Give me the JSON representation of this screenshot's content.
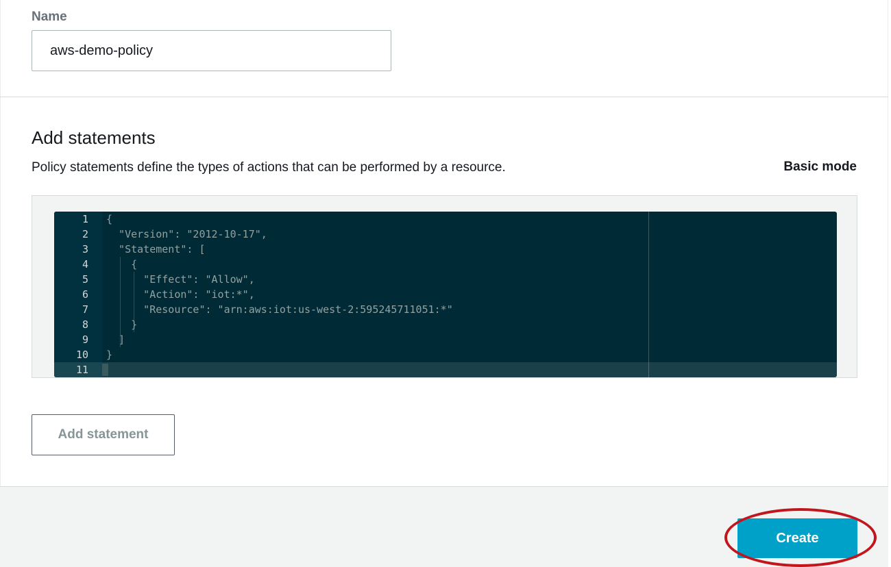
{
  "policy": {
    "name_label": "Name",
    "name_value": "aws-demo-policy"
  },
  "statements": {
    "title": "Add statements",
    "description": "Policy statements define the types of actions that can be performed by a resource.",
    "mode_link": "Basic mode"
  },
  "editor": {
    "lines": [
      {
        "num": "1",
        "code": "{"
      },
      {
        "num": "2",
        "code": "  \"Version\": \"2012-10-17\","
      },
      {
        "num": "3",
        "code": "  \"Statement\": ["
      },
      {
        "num": "4",
        "code": "    {"
      },
      {
        "num": "5",
        "code": "      \"Effect\": \"Allow\","
      },
      {
        "num": "6",
        "code": "      \"Action\": \"iot:*\","
      },
      {
        "num": "7",
        "code": "      \"Resource\": \"arn:aws:iot:us-west-2:595245711051:*\""
      },
      {
        "num": "8",
        "code": "    }"
      },
      {
        "num": "9",
        "code": "  ]"
      },
      {
        "num": "10",
        "code": "}"
      },
      {
        "num": "11",
        "code": ""
      }
    ]
  },
  "actions": {
    "add_statement_label": "Add statement",
    "create_label": "Create"
  },
  "colors": {
    "primary_button": "#00a1c9",
    "highlight_ring": "#c0161c",
    "editor_bg": "#002b36"
  }
}
